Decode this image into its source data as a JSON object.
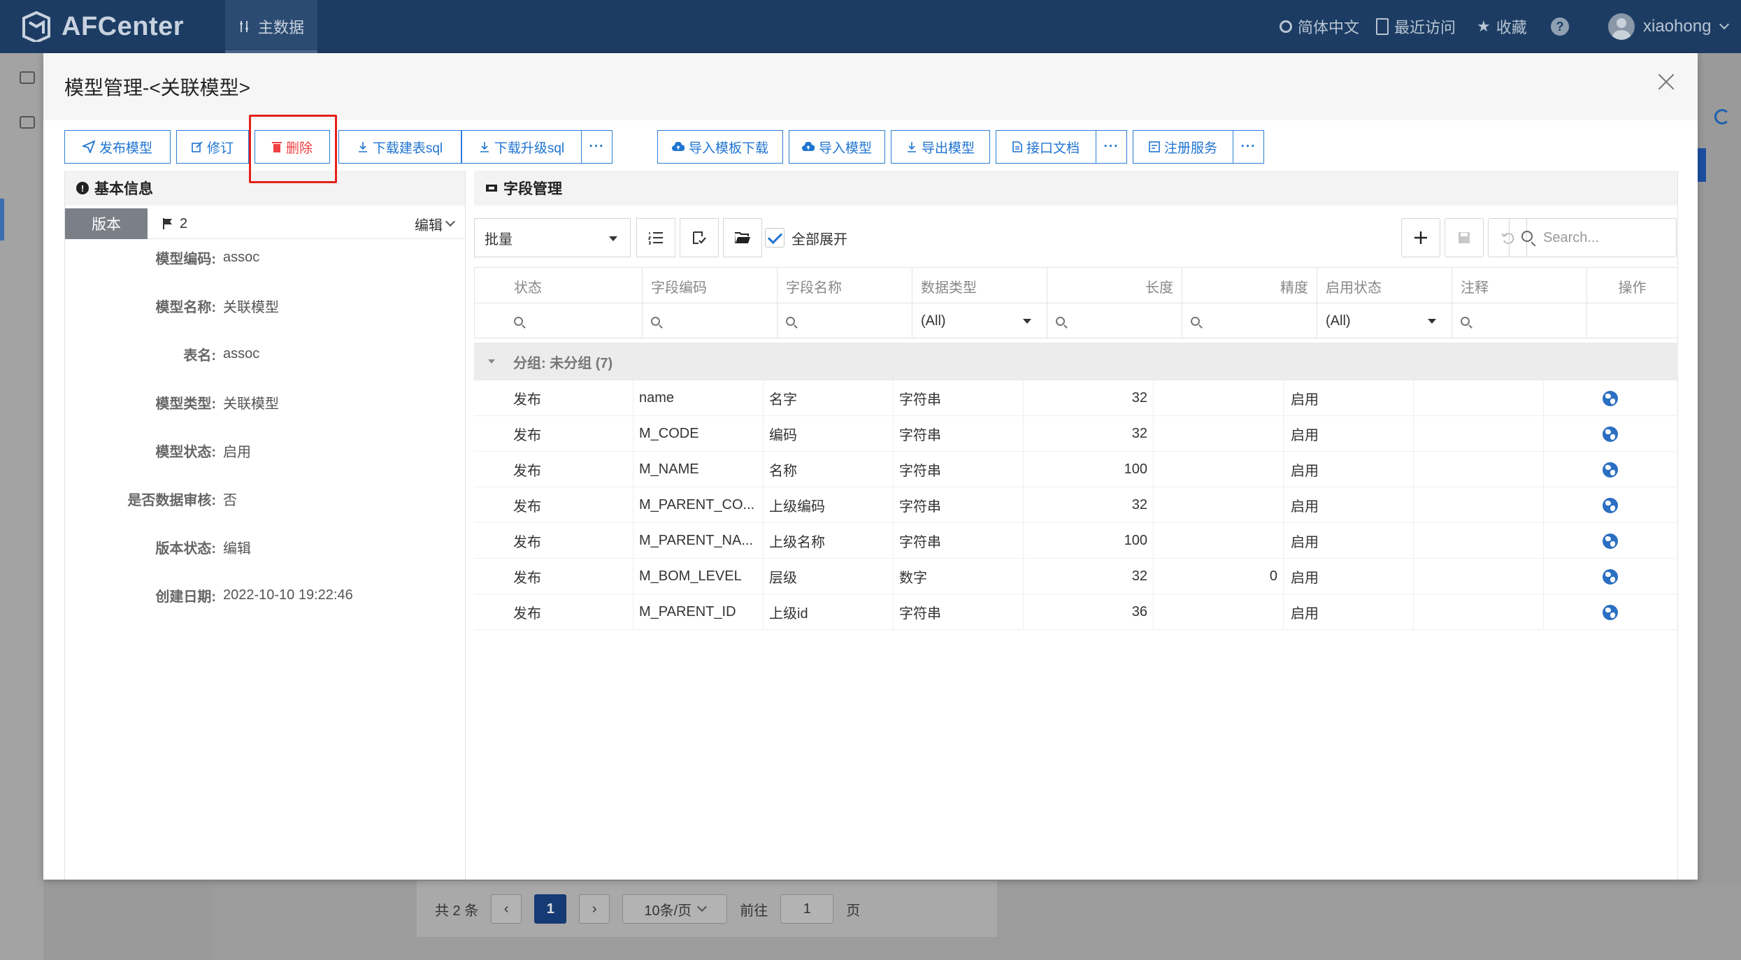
{
  "app": {
    "logo_text": "AFCenter",
    "nav_item": "主数据",
    "language": "简体中文",
    "recent": "最近访问",
    "favorites": "收藏",
    "help": "?",
    "username": "xiaohong"
  },
  "pager": {
    "total": "共 2 条",
    "prev": "‹",
    "current_page": "1",
    "next": "›",
    "page_size": "10条/页",
    "goto_label": "前往",
    "goto_value": "1",
    "page_suffix": "页"
  },
  "modal": {
    "title": "模型管理-<关联模型>",
    "toolbar": {
      "publish": "发布模型",
      "revise": "修订",
      "delete": "删除",
      "download_create_sql": "下载建表sql",
      "download_upgrade_sql": "下载升级sql",
      "more": "···",
      "import_template": "导入模板下载",
      "import_model": "导入模型",
      "export_model": "导出模型",
      "api_doc": "接口文档",
      "register_service": "注册服务"
    },
    "basic_info": {
      "title": "基本信息",
      "version_tab": "版本",
      "version_number": "2",
      "edit_label": "编辑",
      "fields": [
        {
          "label": "模型编码:",
          "value": "assoc"
        },
        {
          "label": "模型名称:",
          "value": "关联模型"
        },
        {
          "label": "表名:",
          "value": "assoc"
        },
        {
          "label": "模型类型:",
          "value": "关联模型"
        },
        {
          "label": "模型状态:",
          "value": "启用"
        },
        {
          "label": "是否数据审核:",
          "value": "否"
        },
        {
          "label": "版本状态:",
          "value": "编辑"
        },
        {
          "label": "创建日期:",
          "value": "2022-10-10 19:22:46"
        }
      ]
    },
    "field_mgmt": {
      "title": "字段管理",
      "batch_select": "批量",
      "expand_all": "全部展开",
      "search_placeholder": "Search...",
      "columns": [
        "状态",
        "字段编码",
        "字段名称",
        "数据类型",
        "长度",
        "精度",
        "启用状态",
        "注释",
        "操作"
      ],
      "filter_all": "(All)",
      "group_label": "分组: 未分组 (7)",
      "rows": [
        {
          "status": "发布",
          "code": "name",
          "name": "名字",
          "type": "字符串",
          "length": "32",
          "precision": "",
          "enabled": "启用",
          "comment": ""
        },
        {
          "status": "发布",
          "code": "M_CODE",
          "name": "编码",
          "type": "字符串",
          "length": "32",
          "precision": "",
          "enabled": "启用",
          "comment": ""
        },
        {
          "status": "发布",
          "code": "M_NAME",
          "name": "名称",
          "type": "字符串",
          "length": "100",
          "precision": "",
          "enabled": "启用",
          "comment": ""
        },
        {
          "status": "发布",
          "code": "M_PARENT_CO...",
          "name": "上级编码",
          "type": "字符串",
          "length": "32",
          "precision": "",
          "enabled": "启用",
          "comment": ""
        },
        {
          "status": "发布",
          "code": "M_PARENT_NA...",
          "name": "上级名称",
          "type": "字符串",
          "length": "100",
          "precision": "",
          "enabled": "启用",
          "comment": ""
        },
        {
          "status": "发布",
          "code": "M_BOM_LEVEL",
          "name": "层级",
          "type": "数字",
          "length": "32",
          "precision": "0",
          "enabled": "启用",
          "comment": ""
        },
        {
          "status": "发布",
          "code": "M_PARENT_ID",
          "name": "上级id",
          "type": "字符串",
          "length": "36",
          "precision": "",
          "enabled": "启用",
          "comment": ""
        }
      ]
    }
  },
  "colors": {
    "accent": "#1f74d0",
    "danger": "#f04040",
    "highlight": "#e5201a",
    "topbar": "#1c3c63"
  }
}
